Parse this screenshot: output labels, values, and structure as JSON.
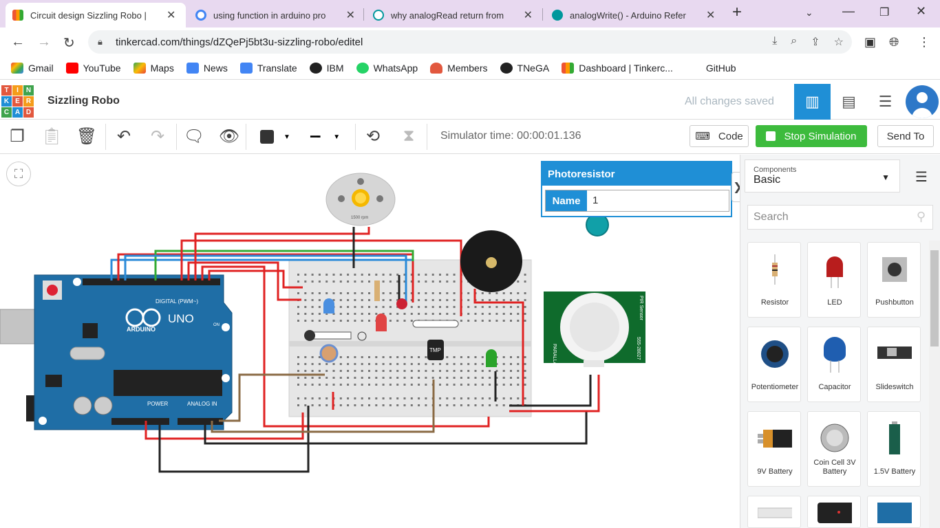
{
  "browser": {
    "tabs": [
      {
        "title": "Circuit design Sizzling Robo |",
        "active": true
      },
      {
        "title": "using function in arduino pro",
        "active": false
      },
      {
        "title": "why analogRead return from",
        "active": false
      },
      {
        "title": "analogWrite() - Arduino Refer",
        "active": false
      }
    ],
    "new_tab": "+",
    "url": "tinkercad.com/things/dZQePj5bt3u-sizzling-robo/editel",
    "bookmarks": [
      "Gmail",
      "YouTube",
      "Maps",
      "News",
      "Translate",
      "IBM",
      "WhatsApp",
      "Members",
      "TNeGA",
      "Dashboard | Tinkerc...",
      "GitHub"
    ]
  },
  "app": {
    "logo_letters": [
      "TIN",
      "KER",
      "CAD"
    ],
    "project_name": "Sizzling Robo",
    "save_status": "All changes saved"
  },
  "toolbar": {
    "sim_time": "Simulator time: 00:00:01.136",
    "code_label": "Code",
    "stop_label": "Stop Simulation",
    "send_label": "Send To"
  },
  "inspector": {
    "title": "Photoresistor",
    "name_label": "Name",
    "name_value": "1"
  },
  "panel": {
    "components_label": "Components",
    "components_value": "Basic",
    "search_placeholder": "Search",
    "items": [
      "Resistor",
      "LED",
      "Pushbutton",
      "Potentiometer",
      "Capacitor",
      "Slideswitch",
      "9V Battery",
      "Coin Cell 3V Battery",
      "1.5V Battery"
    ]
  },
  "circuit": {
    "arduino_labels": [
      "DIGITAL (PWM~)",
      "ARDUINO",
      "UNO",
      "POWER",
      "ANALOG IN",
      "ON"
    ],
    "motor_label": "1500 rpm",
    "pir_labels": [
      "PARALLAX",
      "555-28027",
      "PIR Sensor"
    ],
    "tmp_label": "TMP",
    "colors": {
      "wire_red": "#e02222",
      "wire_black": "#222222",
      "wire_blue": "#2a8ad8",
      "wire_green": "#33aa33",
      "wire_brown": "#8a6a44",
      "arduino": "#1f6ea6",
      "pir": "#0f6b2c"
    }
  }
}
